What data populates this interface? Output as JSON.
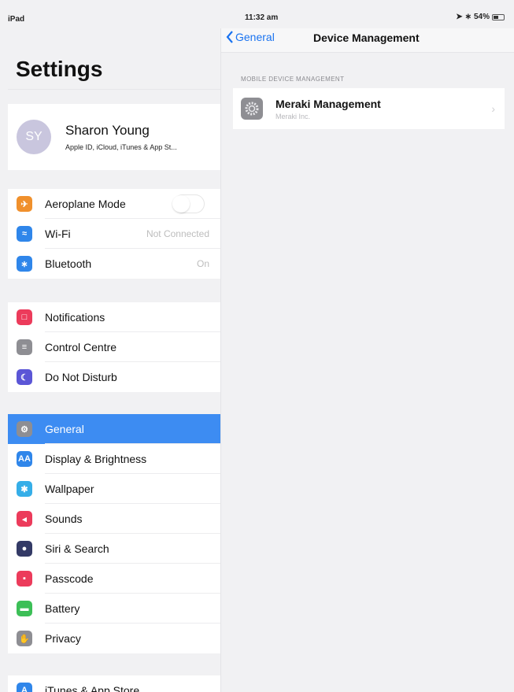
{
  "status_bar": {
    "device": "iPad",
    "time": "11:32 am",
    "battery": "54%",
    "battery_level": 0.54
  },
  "sidebar": {
    "title": "Settings",
    "profile": {
      "initials": "SY",
      "name": "Sharon Young",
      "subtitle": "Apple ID, iCloud, iTunes & App St..."
    },
    "group1": [
      {
        "label": "Aeroplane Mode",
        "icon": "airplane-icon",
        "color": "#f0902c",
        "toggle": false
      },
      {
        "label": "Wi-Fi",
        "icon": "wifi-icon",
        "color": "#2f86ea",
        "value": "Not Connected"
      },
      {
        "label": "Bluetooth",
        "icon": "bluetooth-icon",
        "color": "#2f86ea",
        "value": "On"
      }
    ],
    "group2": [
      {
        "label": "Notifications",
        "icon": "notifications-icon",
        "color": "#ec3b5b"
      },
      {
        "label": "Control Centre",
        "icon": "control-centre-icon",
        "color": "#8e8e93"
      },
      {
        "label": "Do Not Disturb",
        "icon": "moon-icon",
        "color": "#5b56d6"
      }
    ],
    "group3": [
      {
        "label": "General",
        "icon": "gear-icon",
        "color": "#8e8e93",
        "selected": true
      },
      {
        "label": "Display & Brightness",
        "icon": "display-icon",
        "color": "#2f86ea"
      },
      {
        "label": "Wallpaper",
        "icon": "wallpaper-icon",
        "color": "#35aee8"
      },
      {
        "label": "Sounds",
        "icon": "speaker-icon",
        "color": "#ec3b5b"
      },
      {
        "label": "Siri & Search",
        "icon": "siri-icon",
        "color": "#333a66"
      },
      {
        "label": "Passcode",
        "icon": "lock-icon",
        "color": "#ec3b5b"
      },
      {
        "label": "Battery",
        "icon": "battery-icon",
        "color": "#3cbf57"
      },
      {
        "label": "Privacy",
        "icon": "hand-icon",
        "color": "#8e8e93"
      }
    ],
    "group4": [
      {
        "label": "iTunes & App Store",
        "icon": "app-store-icon",
        "color": "#2f86ea"
      }
    ]
  },
  "detail": {
    "back_label": "General",
    "title": "Device Management",
    "section_header": "MOBILE DEVICE MANAGEMENT",
    "item": {
      "title": "Meraki Management",
      "subtitle": "Meraki Inc."
    }
  }
}
